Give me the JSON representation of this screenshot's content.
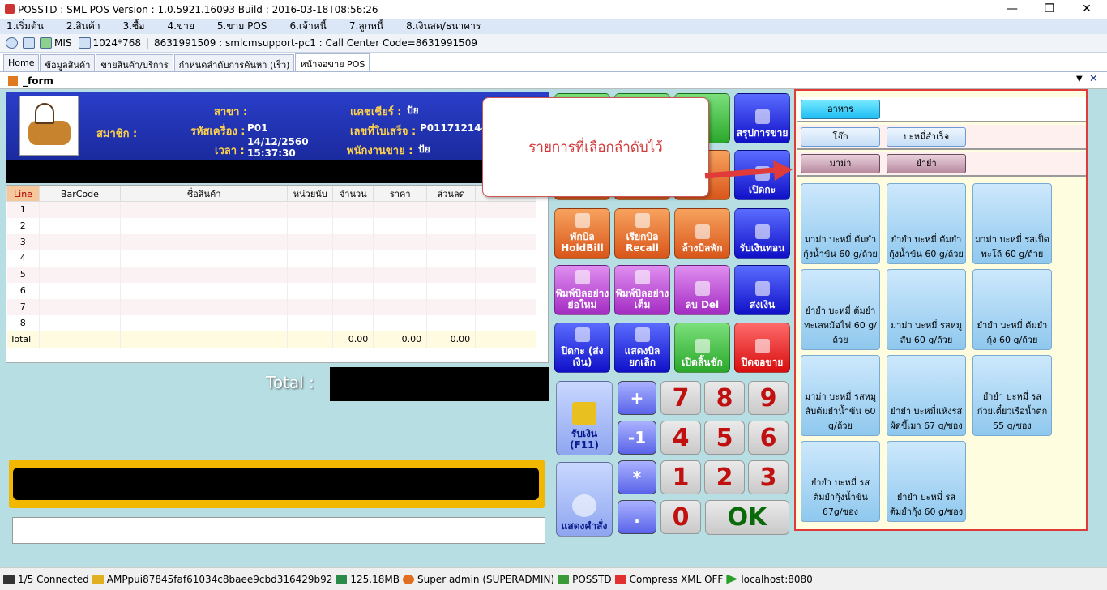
{
  "window": {
    "title": "POSSTD : SML POS Version : 1.0.5921.16093  Build : 2016-03-18T08:56:26"
  },
  "menu": [
    "1.เริ่มต้น",
    "2.สินค้า",
    "3.ซื้อ",
    "4.ขาย",
    "5.ขาย POS",
    "6.เจ้าหนี้",
    "7.ลูกหนี้",
    "8.เงินสด/ธนาคาร"
  ],
  "infobar": {
    "mis": "MIS",
    "resolution": "1024*768",
    "session": "8631991509 : smlcmsupport-pc1 : Call Center Code=8631991509"
  },
  "tabs": [
    "Home",
    "ข้อมูลสินค้า",
    "ขายสินค้า/บริการ",
    "กำหนดลำดับการค้นหา (เร็ว)",
    "หน้าจอขาย POS"
  ],
  "form_title": "_form",
  "header": {
    "branch_label": "สาขา :",
    "member_label": "สมาชิก :",
    "machine_label": "รหัสเครื่อง :",
    "machine_value": "P01",
    "time_label": "เวลา :",
    "date_value": "14/12/2560",
    "time_value": "15:37:30",
    "cashier_label": "แคชเชียร์ :",
    "cashier_value": "ปัย",
    "receipt_label": "เลขที่ใบเสร็จ :",
    "receipt_value": "P01171214-",
    "seller_label": "พนักงานขาย :",
    "seller_value": "ปัย"
  },
  "grid": {
    "columns": [
      "Line",
      "BarCode",
      "ชื่อสินค้า",
      "หน่วยนับ",
      "จำนวน",
      "ราคา",
      "ส่วนลด"
    ],
    "rows": [
      "1",
      "2",
      "3",
      "4",
      "5",
      "6",
      "7",
      "8"
    ],
    "total_label": "Total",
    "total_qty": "0.00",
    "total_price": "0.00",
    "total_discount": "0.00"
  },
  "total_label": "Total :",
  "buttons": {
    "summary": "สรุปการขาย",
    "open_shift": "เปิดกะ",
    "hold": "พักบิล HoldBill",
    "recall": "เรียกบิล Recall",
    "clear_hold": "ล้างบิลพัก",
    "receive_change": "รับเงินทอน",
    "print_short": "พิมพ์บิลอย่างย่อใหม่",
    "print_full": "พิมพ์บิลอย่างเต็ม",
    "delete": "ลบ Del",
    "send_money": "ส่งเงิน",
    "close_shift": "ปิดกะ (ส่งเงิน)",
    "show_cancel": "แสดงบิลยกเลิก",
    "open_drawer": "เปิดลิ้นชัก",
    "close_screen": "ปิดจอขาย",
    "receive_money": "รับเงิน (F11)",
    "show_command": "แสดงคำสั่ง",
    "plus": "+",
    "minus1": "-1",
    "multiply": "*",
    "dot": ".",
    "k7": "7",
    "k8": "8",
    "k9": "9",
    "k4": "4",
    "k5": "5",
    "k6": "6",
    "k1": "1",
    "k2": "2",
    "k3": "3",
    "k0": "0",
    "ok": "OK"
  },
  "callout": "รายการที่เลือกลำดับไว้",
  "categories": {
    "level1": [
      "อาหาร"
    ],
    "level2": [
      "โจ๊ก",
      "บะหมี่สำเร็จ"
    ],
    "level3": [
      "มาม่า",
      "ยำยำ"
    ]
  },
  "products": [
    "มาม่า บะหมี่ ต้มยำกุ้งน้ำข้น 60 g/ถ้วย",
    "ยำยำ บะหมี่ ต้มยำกุ้งน้ำข้น 60 g/ถ้วย",
    "มาม่า บะหมี่ รสเป็ดพะโล้ 60 g/ถ้วย",
    "ยำยำ บะหมี่ ต้มยำทะเลหม้อไฟ 60 g/ถ้วย",
    "มาม่า บะหมี่ รสหมูสับ 60 g/ถ้วย",
    "ยำยำ บะหมี่ ต้มยำกุ้ง 60 g/ถ้วย",
    "มาม่า บะหมี่ รสหมูสับต้มยำน้ำข้น 60 g/ถ้วย",
    "ยำยำ บะหมี่แห้งรสผัดขี้เมา 67 g/ซอง",
    "ยำยำ บะหมี่ รสก๋วยเตี๋ยวเรือน้ำตก 55 g/ซอง",
    "ยำยำ บะหมี่ รสต้มยำกุ้งน้ำข้น 67g/ซอง",
    "ยำยำ บะหมี่ รสต้มยำกุ้ง 60 g/ซอง"
  ],
  "status": {
    "connected": "1/5 Connected",
    "key": "AMPpui87845faf61034c8baee9cbd316429b92",
    "memory": "125.18MB",
    "user": "Super admin (SUPERADMIN)",
    "app": "POSSTD",
    "compress": "Compress XML OFF",
    "host": "localhost:8080"
  }
}
